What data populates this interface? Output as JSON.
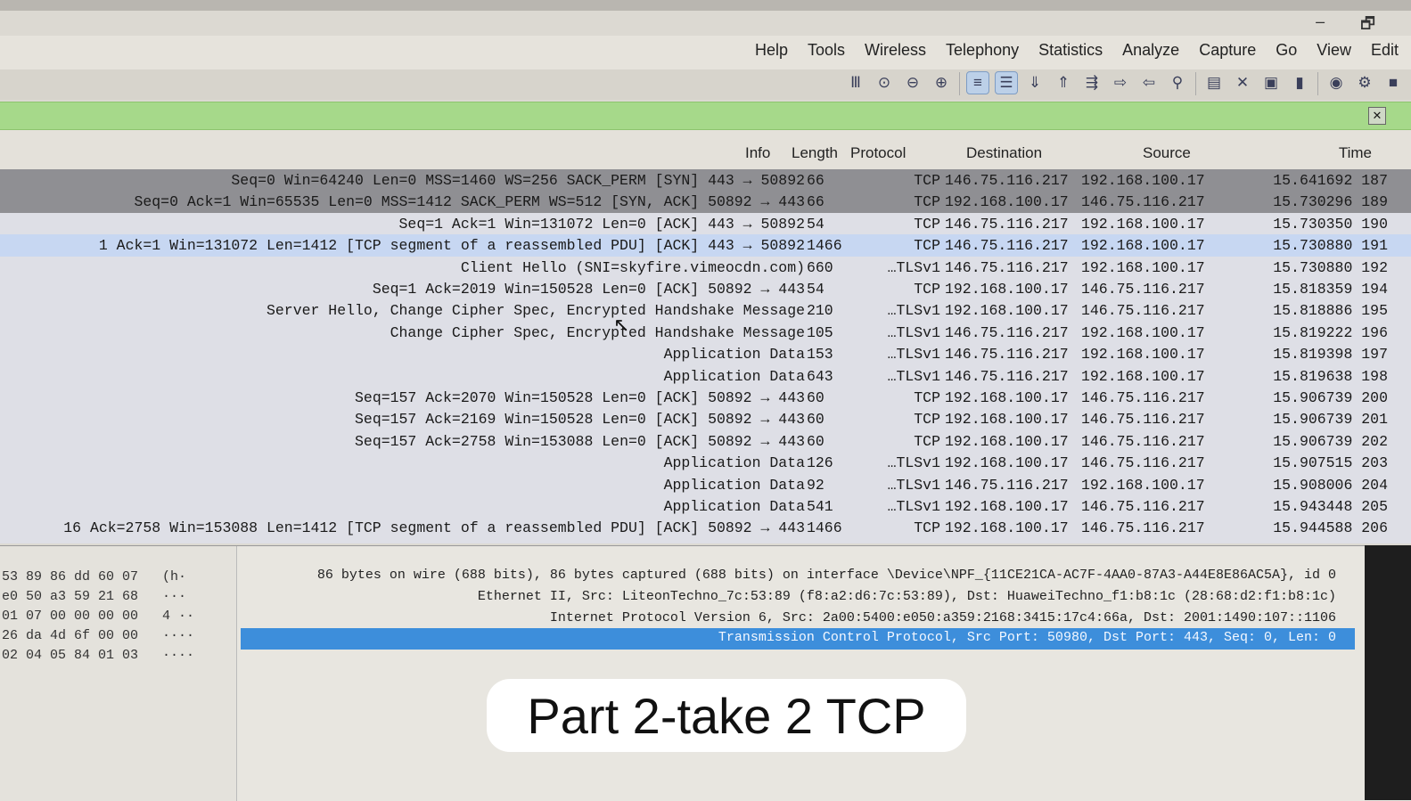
{
  "window": {
    "minimize": "–",
    "restore": "🗗"
  },
  "menu": [
    "Edit",
    "View",
    "Go",
    "Capture",
    "Analyze",
    "Statistics",
    "Telephony",
    "Wireless",
    "Tools",
    "Help"
  ],
  "columns": {
    "time": "Time",
    "source": "Source",
    "destination": "Destination",
    "protocol": "Protocol",
    "length": "Length",
    "info": "Info"
  },
  "packets": [
    {
      "no": "187",
      "time": "15.641692",
      "src": "192.168.100.17",
      "dst": "146.75.116.217",
      "proto": "TCP",
      "len": "66",
      "info": "Seq=0 Win=64240 Len=0 MSS=1460 WS=256 SACK_PERM [SYN] 443 → 50892",
      "style": "dark"
    },
    {
      "no": "189",
      "time": "15.730296",
      "src": "146.75.116.217",
      "dst": "192.168.100.17",
      "proto": "TCP",
      "len": "66",
      "info": "Seq=0 Ack=1 Win=65535 Len=0 MSS=1412 SACK_PERM WS=512 [SYN, ACK] 50892 → 443",
      "style": "dark"
    },
    {
      "no": "190",
      "time": "15.730350",
      "src": "192.168.100.17",
      "dst": "146.75.116.217",
      "proto": "TCP",
      "len": "54",
      "info": "Seq=1 Ack=1 Win=131072 Len=0 [ACK] 443 → 50892",
      "style": ""
    },
    {
      "no": "191",
      "time": "15.730880",
      "src": "192.168.100.17",
      "dst": "146.75.116.217",
      "proto": "TCP",
      "len": "1466",
      "info": "1 Ack=1 Win=131072 Len=1412 [TCP segment of a reassembled PDU] [ACK] 443 → 50892",
      "style": "blue"
    },
    {
      "no": "192",
      "time": "15.730880",
      "src": "192.168.100.17",
      "dst": "146.75.116.217",
      "proto": "…TLSv1",
      "len": "660",
      "info": "Client Hello (SNI=skyfire.vimeocdn.com)",
      "style": ""
    },
    {
      "no": "194",
      "time": "15.818359",
      "src": "146.75.116.217",
      "dst": "192.168.100.17",
      "proto": "TCP",
      "len": "54",
      "info": "Seq=1 Ack=2019 Win=150528 Len=0 [ACK] 50892 → 443",
      "style": ""
    },
    {
      "no": "195",
      "time": "15.818886",
      "src": "146.75.116.217",
      "dst": "192.168.100.17",
      "proto": "…TLSv1",
      "len": "210",
      "info": "Server Hello, Change Cipher Spec, Encrypted Handshake Message",
      "style": ""
    },
    {
      "no": "196",
      "time": "15.819222",
      "src": "192.168.100.17",
      "dst": "146.75.116.217",
      "proto": "…TLSv1",
      "len": "105",
      "info": "Change Cipher Spec, Encrypted Handshake Message",
      "style": ""
    },
    {
      "no": "197",
      "time": "15.819398",
      "src": "192.168.100.17",
      "dst": "146.75.116.217",
      "proto": "…TLSv1",
      "len": "153",
      "info": "Application Data",
      "style": ""
    },
    {
      "no": "198",
      "time": "15.819638",
      "src": "192.168.100.17",
      "dst": "146.75.116.217",
      "proto": "…TLSv1",
      "len": "643",
      "info": "Application Data",
      "style": ""
    },
    {
      "no": "200",
      "time": "15.906739",
      "src": "146.75.116.217",
      "dst": "192.168.100.17",
      "proto": "TCP",
      "len": "60",
      "info": "Seq=157 Ack=2070 Win=150528 Len=0 [ACK] 50892 → 443",
      "style": ""
    },
    {
      "no": "201",
      "time": "15.906739",
      "src": "146.75.116.217",
      "dst": "192.168.100.17",
      "proto": "TCP",
      "len": "60",
      "info": "Seq=157 Ack=2169 Win=150528 Len=0 [ACK] 50892 → 443",
      "style": ""
    },
    {
      "no": "202",
      "time": "15.906739",
      "src": "146.75.116.217",
      "dst": "192.168.100.17",
      "proto": "TCP",
      "len": "60",
      "info": "Seq=157 Ack=2758 Win=153088 Len=0 [ACK] 50892 → 443",
      "style": ""
    },
    {
      "no": "203",
      "time": "15.907515",
      "src": "146.75.116.217",
      "dst": "192.168.100.17",
      "proto": "…TLSv1",
      "len": "126",
      "info": "Application Data",
      "style": ""
    },
    {
      "no": "204",
      "time": "15.908006",
      "src": "192.168.100.17",
      "dst": "146.75.116.217",
      "proto": "…TLSv1",
      "len": "92",
      "info": "Application Data",
      "style": ""
    },
    {
      "no": "205",
      "time": "15.943448",
      "src": "146.75.116.217",
      "dst": "192.168.100.17",
      "proto": "…TLSv1",
      "len": "541",
      "info": "Application Data",
      "style": ""
    },
    {
      "no": "206",
      "time": "15.944588",
      "src": "146.75.116.217",
      "dst": "192.168.100.17",
      "proto": "TCP",
      "len": "1466",
      "info": "16 Ack=2758 Win=153088 Len=1412 [TCP segment of a reassembled PDU] [ACK] 50892 → 443",
      "style": ""
    }
  ],
  "details": [
    "86 bytes on wire (688 bits), 86 bytes captured (688 bits) on interface \\Device\\NPF_{11CE21CA-AC7F-4AA0-87A3-A44E8E86AC5A}, id 0",
    "Ethernet II, Src: LiteonTechno_7c:53:89 (f8:a2:d6:7c:53:89), Dst: HuaweiTechno_f1:b8:1c (28:68:d2:f1:b8:1c)",
    "Internet Protocol Version 6, Src: 2a00:5400:e050:a359:2168:3415:17c4:66a, Dst: 2001:1490:107::1106",
    "Transmission Control Protocol, Src Port: 50980, Dst Port: 443, Seq: 0, Len: 0"
  ],
  "hex": [
    "53 89 86 dd 60 07   (h·",
    "e0 50 a3 59 21 68   ···",
    "01 07 00 00 00 00   4 ··",
    "26 da 4d 6f 00 00   ····",
    "02 04 05 84 01 03   ····"
  ],
  "caption": "Part 2-take 2 TCP",
  "colors": {
    "filter_bar": "#a6d98a",
    "selected_row": "#8f8f93",
    "tcp_segment_row": "#c7d7f2",
    "tree_selection": "#3d8edb"
  }
}
